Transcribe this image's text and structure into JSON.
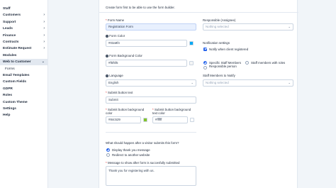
{
  "sidebar": {
    "items": [
      {
        "label": "Staff",
        "chevron": false
      },
      {
        "label": "Customers",
        "chevron": true
      },
      {
        "label": "Support",
        "chevron": true
      },
      {
        "label": "Leads",
        "chevron": true
      },
      {
        "label": "Finance",
        "chevron": true
      },
      {
        "label": "Contracts",
        "chevron": true
      },
      {
        "label": "Estimate Request",
        "chevron": true
      },
      {
        "label": "Modules",
        "chevron": false
      },
      {
        "label": "Web to Customer",
        "chevron": true,
        "expanded": true
      },
      {
        "label": "Forms",
        "sub": true
      },
      {
        "label": "Email Templates",
        "chevron": false
      },
      {
        "label": "Custom Fields",
        "chevron": false
      },
      {
        "label": "GDPR",
        "chevron": false
      },
      {
        "label": "Roles",
        "chevron": false
      },
      {
        "label": "Custom Theme",
        "chevron": false
      },
      {
        "label": "Settings",
        "chevron": false
      },
      {
        "label": "Help",
        "chevron": false
      }
    ],
    "chevron_right": "›",
    "chevron_down": "⌄"
  },
  "form": {
    "intro": "Create form first to be able to use the form builder.",
    "form_name_label": "Form Name",
    "form_name_value": "Registration Form",
    "form_color_label": "Form Color",
    "form_color_value": "#03a9f4",
    "form_bg_color_label": "Form Background Color",
    "form_bg_color_value": "#f5f5f5",
    "language_label": "Language",
    "language_value": "English",
    "submit_text_label": "Submit button text",
    "submit_text_value": "Submit",
    "submit_bg_label_line1": "Submit button background",
    "submit_bg_label_line2": "color",
    "submit_bg_value": "#84c529",
    "submit_text_color_label_line1": "Submit button background",
    "submit_text_color_label_line2": "text color",
    "submit_text_color_value": "#ffffff",
    "after_submit_label": "What should happen after a visitor submits this form?",
    "option_thank_you": "Display thank you message",
    "option_redirect": "Redirect to another website",
    "message_label": "Message to show after form is succesfully submitted",
    "message_value": "Thank you for registering with us.",
    "responsible_label": "Responsible (Assignee)",
    "responsible_placeholder": "Nothing selected",
    "notification_label": "Notification settings",
    "notify_label": "Notify when client registered",
    "specific_staff_line1": "Specific Staff Members",
    "specific_staff_line2": "Responsible person",
    "staff_with_roles": "Staff members with roles",
    "staff_to_notify_label": "Staff Members to Notify",
    "staff_to_notify_placeholder": "Nothing selected",
    "required_mark": "*",
    "info_glyph": "!",
    "select_chevron": "⌄"
  },
  "colors": {
    "form_color": "#03a9f4",
    "form_bg_color": "#f5f5f5",
    "submit_bg": "#84c529",
    "submit_text": "#ffffff",
    "accent": "#2563eb"
  }
}
